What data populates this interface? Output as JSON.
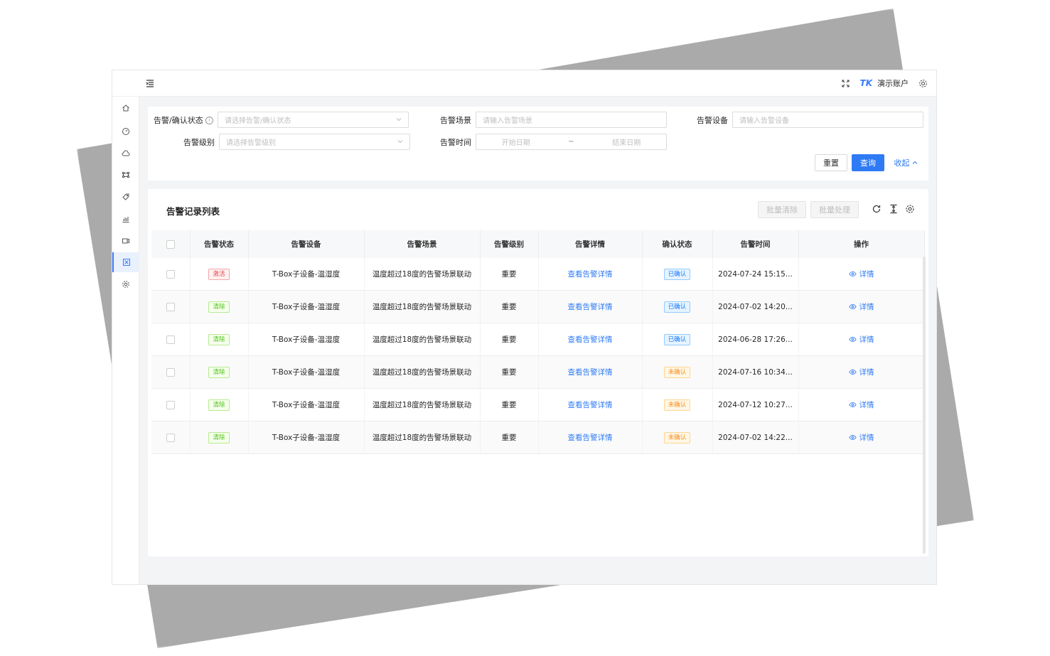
{
  "topbar": {
    "account": "演示账户",
    "logo": "TK"
  },
  "filters": {
    "status_label": "告警/确认状态",
    "status_placeholder": "请选择告警/确认状态",
    "scene_label": "告警场景",
    "scene_placeholder": "请输入告警场景",
    "device_label": "告警设备",
    "device_placeholder": "请输入告警设备",
    "level_label": "告警级别",
    "level_placeholder": "请选择告警级别",
    "time_label": "告警时间",
    "start_placeholder": "开始日期",
    "range_sep": "~",
    "end_placeholder": "结束日期",
    "reset": "重置",
    "query": "查询",
    "collapse": "收起"
  },
  "list": {
    "title": "告警记录列表",
    "batch_clear": "批量清除",
    "batch_handle": "批量处理",
    "columns": [
      "告警状态",
      "告警设备",
      "告警场景",
      "告警级别",
      "告警详情",
      "确认状态",
      "告警时间",
      "操作"
    ],
    "rows": [
      {
        "status": "激活",
        "status_color": "red",
        "device": "T-Box子设备-温湿度",
        "scene": "温度超过18度的告警场景联动",
        "level": "重要",
        "detail": "查看告警详情",
        "confirm": "已确认",
        "confirm_color": "blue",
        "time": "2024-07-24 15:15...",
        "op": "详情"
      },
      {
        "status": "清除",
        "status_color": "green",
        "device": "T-Box子设备-温湿度",
        "scene": "温度超过18度的告警场景联动",
        "level": "重要",
        "detail": "查看告警详情",
        "confirm": "已确认",
        "confirm_color": "blue",
        "time": "2024-07-02 14:20...",
        "op": "详情"
      },
      {
        "status": "清除",
        "status_color": "green",
        "device": "T-Box子设备-温湿度",
        "scene": "温度超过18度的告警场景联动",
        "level": "重要",
        "detail": "查看告警详情",
        "confirm": "已确认",
        "confirm_color": "blue",
        "time": "2024-06-28 17:26...",
        "op": "详情"
      },
      {
        "status": "清除",
        "status_color": "green",
        "device": "T-Box子设备-温湿度",
        "scene": "温度超过18度的告警场景联动",
        "level": "重要",
        "detail": "查看告警详情",
        "confirm": "未确认",
        "confirm_color": "orange",
        "time": "2024-07-16 10:34...",
        "op": "详情"
      },
      {
        "status": "清除",
        "status_color": "green",
        "device": "T-Box子设备-温湿度",
        "scene": "温度超过18度的告警场景联动",
        "level": "重要",
        "detail": "查看告警详情",
        "confirm": "未确认",
        "confirm_color": "orange",
        "time": "2024-07-12 10:27...",
        "op": "详情"
      },
      {
        "status": "清除",
        "status_color": "green",
        "device": "T-Box子设备-温湿度",
        "scene": "温度超过18度的告警场景联动",
        "level": "重要",
        "detail": "查看告警详情",
        "confirm": "未确认",
        "confirm_color": "orange",
        "time": "2024-07-02 14:22...",
        "op": "详情"
      }
    ]
  },
  "colors": {
    "accent": "#2f7bf5",
    "active_bg": "#e9f1ff"
  }
}
